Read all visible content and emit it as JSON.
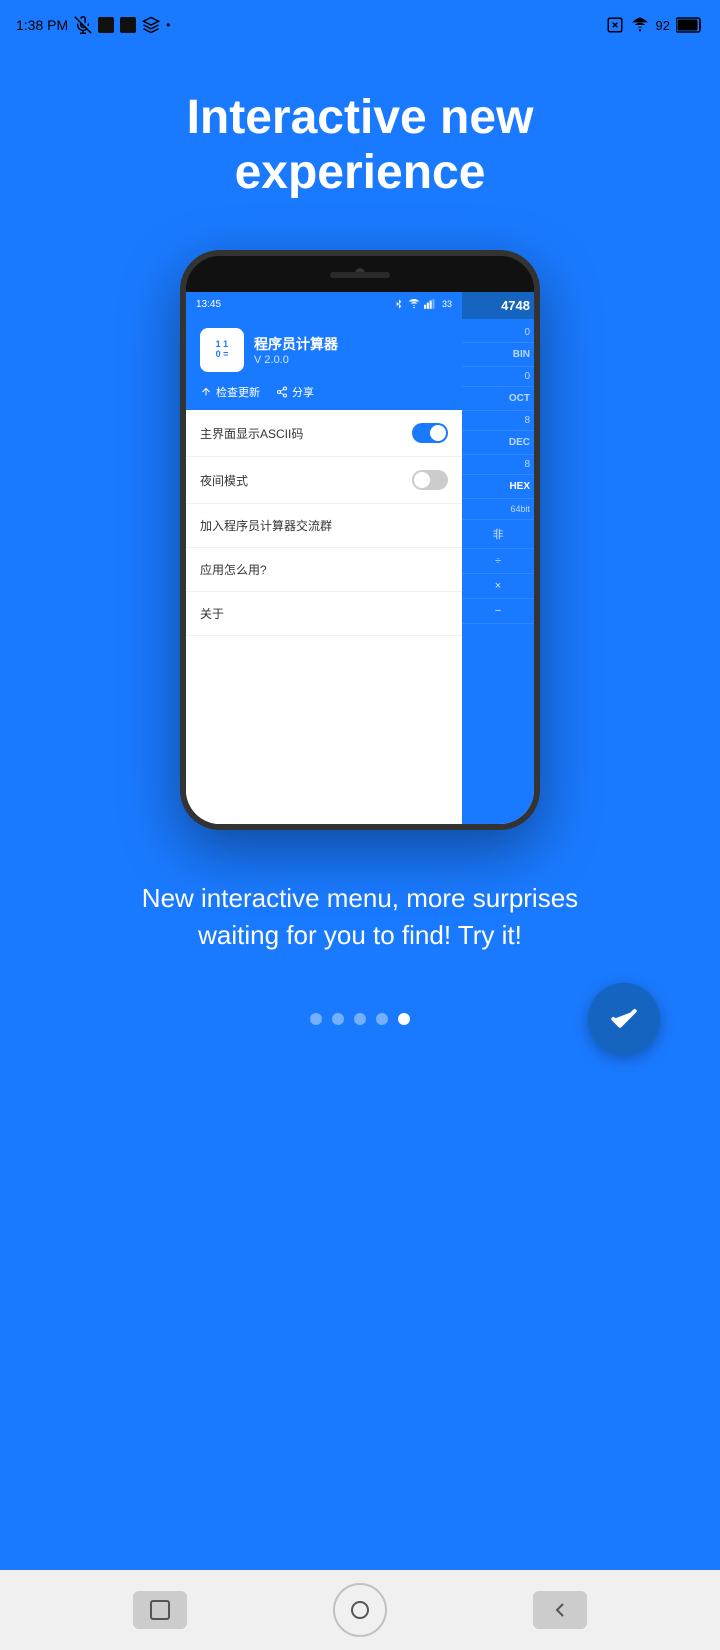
{
  "statusBar": {
    "time": "1:38 PM",
    "battery": "92"
  },
  "headline": {
    "line1": "Interactive new",
    "line2": "experience"
  },
  "phoneScreen": {
    "statusTime": "13:45",
    "appName": "程序员计算器",
    "appVersion": "V 2.0.0",
    "appIconText": "1 1\n0 =",
    "actionCheck": "检查更新",
    "actionShare": "分享",
    "menuItems": [
      {
        "label": "主界面显示ASCII码",
        "toggle": "on"
      },
      {
        "label": "夜间模式",
        "toggle": "off"
      },
      {
        "label": "加入程序员计算器交流群",
        "toggle": "none"
      },
      {
        "label": "应用怎么用?",
        "toggle": "none"
      },
      {
        "label": "关于",
        "toggle": "none"
      }
    ],
    "calcDisplay": "4748",
    "calcBases": [
      {
        "label": "BIN",
        "active": false
      },
      {
        "label": "OCT",
        "active": false
      },
      {
        "label": "DEC",
        "active": false
      },
      {
        "label": "HEX",
        "active": true
      }
    ],
    "calcBits": "64bit",
    "calcOps": [
      "非",
      "÷",
      "×",
      "−"
    ]
  },
  "description": "New interactive menu, more surprises waiting for you to find! Try it!",
  "pagination": {
    "dots": [
      {
        "active": false
      },
      {
        "active": false
      },
      {
        "active": false
      },
      {
        "active": false
      },
      {
        "active": true
      }
    ],
    "checkLabel": "✓"
  },
  "bottomNav": {
    "backLabel": "◁",
    "homeLabel": "○",
    "recentLabel": "□"
  }
}
